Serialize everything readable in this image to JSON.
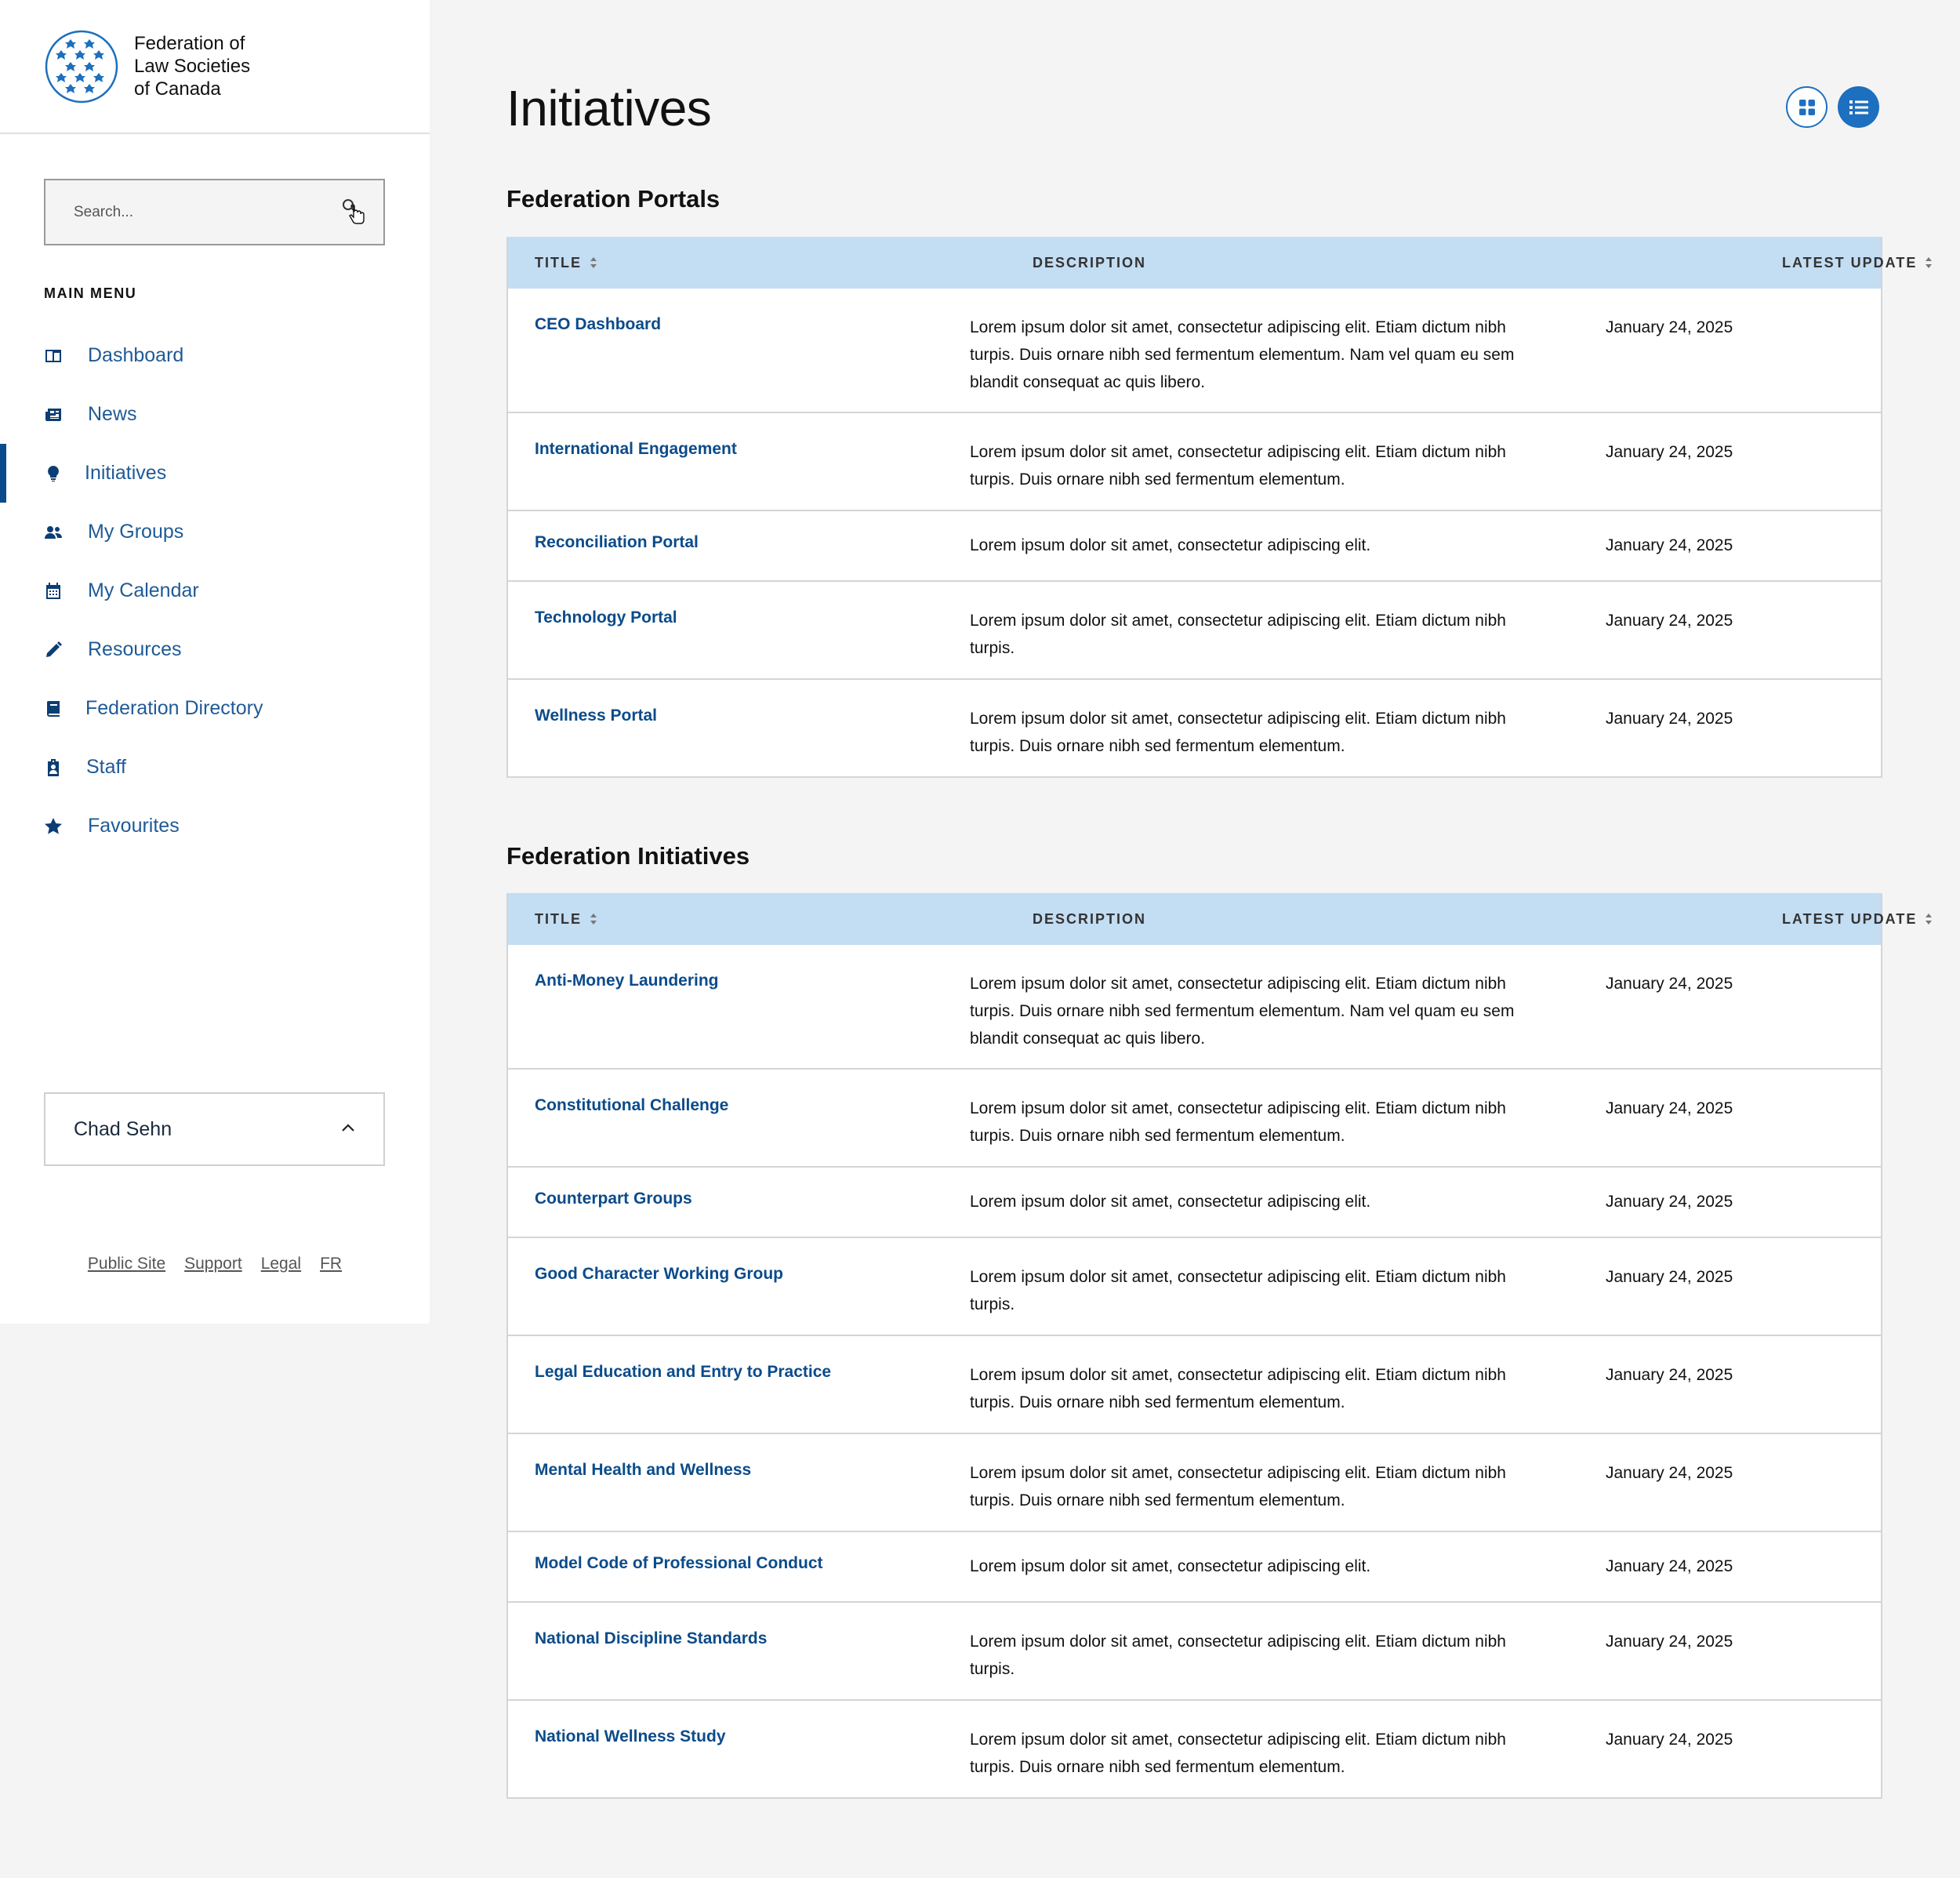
{
  "brand": {
    "name_line1": "Federation of",
    "name_line2": "Law Societies",
    "name_line3": "of Canada",
    "accent": "#1d6fbf"
  },
  "search": {
    "placeholder": "Search..."
  },
  "menu": {
    "heading": "MAIN MENU",
    "items": [
      {
        "label": "Dashboard",
        "icon": "dashboard-icon"
      },
      {
        "label": "News",
        "icon": "newspaper-icon"
      },
      {
        "label": "Initiatives",
        "icon": "lightbulb-icon",
        "active": true
      },
      {
        "label": "My Groups",
        "icon": "users-icon"
      },
      {
        "label": "My Calendar",
        "icon": "calendar-icon"
      },
      {
        "label": "Resources",
        "icon": "pencil-icon"
      },
      {
        "label": "Federation Directory",
        "icon": "book-icon"
      },
      {
        "label": "Staff",
        "icon": "id-badge-icon"
      },
      {
        "label": "Favourites",
        "icon": "star-icon"
      }
    ]
  },
  "user": {
    "name": "Chad Sehn"
  },
  "footer": {
    "links": [
      "Public Site",
      "Support",
      "Legal",
      "FR"
    ]
  },
  "page": {
    "title": "Initiatives"
  },
  "columns": {
    "title": "TITLE",
    "description": "DESCRIPTION",
    "latest_update": "LATEST UPDATE"
  },
  "portals": {
    "heading": "Federation Portals",
    "rows": [
      {
        "title": "CEO Dashboard",
        "description": "Lorem ipsum dolor sit amet, consectetur adipiscing elit. Etiam dictum nibh turpis. Duis ornare nibh sed fermentum elementum. Nam vel quam eu sem blandit consequat ac quis libero.",
        "date": "January 24, 2025"
      },
      {
        "title": "International Engagement",
        "description": "Lorem ipsum dolor sit amet, consectetur adipiscing elit. Etiam dictum nibh turpis. Duis ornare nibh sed fermentum elementum.",
        "date": "January 24, 2025"
      },
      {
        "title": "Reconciliation Portal",
        "description": "Lorem ipsum dolor sit amet, consectetur adipiscing elit.",
        "date": "January 24, 2025"
      },
      {
        "title": "Technology Portal",
        "description": "Lorem ipsum dolor sit amet, consectetur adipiscing elit. Etiam dictum nibh turpis.",
        "date": "January 24, 2025"
      },
      {
        "title": "Wellness Portal",
        "description": "Lorem ipsum dolor sit amet, consectetur adipiscing elit. Etiam dictum nibh turpis. Duis ornare nibh sed fermentum elementum.",
        "date": "January 24, 2025"
      }
    ]
  },
  "initiatives": {
    "heading": "Federation Initiatives",
    "rows": [
      {
        "title": "Anti-Money Laundering",
        "description": "Lorem ipsum dolor sit amet, consectetur adipiscing elit. Etiam dictum nibh turpis. Duis ornare nibh sed fermentum elementum. Nam vel quam eu sem blandit consequat ac quis libero.",
        "date": "January 24, 2025"
      },
      {
        "title": "Constitutional Challenge",
        "description": "Lorem ipsum dolor sit amet, consectetur adipiscing elit. Etiam dictum nibh turpis. Duis ornare nibh sed fermentum elementum.",
        "date": "January 24, 2025"
      },
      {
        "title": "Counterpart Groups",
        "description": "Lorem ipsum dolor sit amet, consectetur adipiscing elit.",
        "date": "January 24, 2025"
      },
      {
        "title": "Good Character Working Group",
        "description": "Lorem ipsum dolor sit amet, consectetur adipiscing elit. Etiam dictum nibh turpis.",
        "date": "January 24, 2025"
      },
      {
        "title": "Legal Education and Entry to Practice",
        "description": "Lorem ipsum dolor sit amet, consectetur adipiscing elit. Etiam dictum nibh turpis. Duis ornare nibh sed fermentum elementum.",
        "date": "January 24, 2025"
      },
      {
        "title": "Mental Health and Wellness",
        "description": "Lorem ipsum dolor sit amet, consectetur adipiscing elit. Etiam dictum nibh turpis. Duis ornare nibh sed fermentum elementum.",
        "date": "January 24, 2025"
      },
      {
        "title": "Model Code of Professional Conduct",
        "description": "Lorem ipsum dolor sit amet, consectetur adipiscing elit.",
        "date": "January 24, 2025"
      },
      {
        "title": "National Discipline Standards",
        "description": "Lorem ipsum dolor sit amet, consectetur adipiscing elit. Etiam dictum nibh turpis.",
        "date": "January 24, 2025"
      },
      {
        "title": "National Wellness Study",
        "description": "Lorem ipsum dolor sit amet, consectetur adipiscing elit. Etiam dictum nibh turpis. Duis ornare nibh sed fermentum elementum.",
        "date": "January 24, 2025"
      }
    ]
  }
}
